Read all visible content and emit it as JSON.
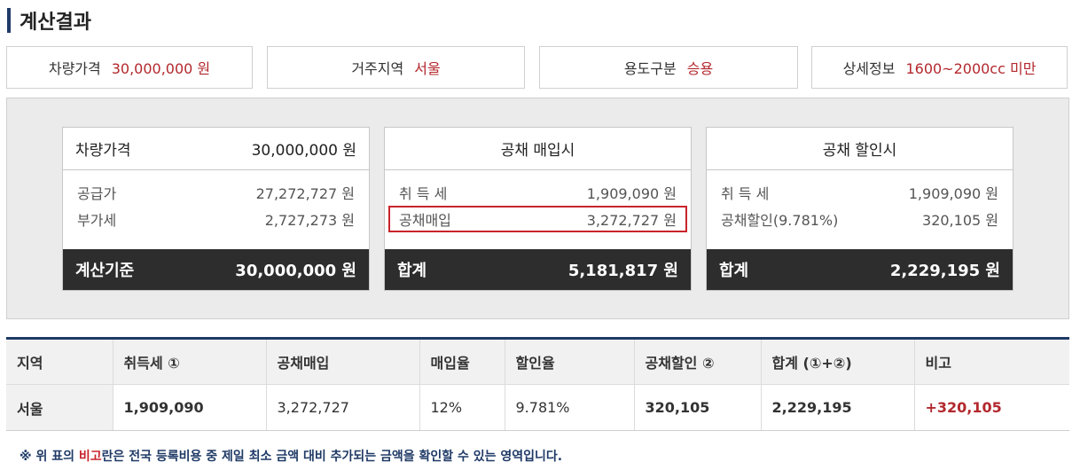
{
  "title": "계산결과",
  "summary": [
    {
      "label": "차량가격",
      "value": "30,000,000 원"
    },
    {
      "label": "거주지역",
      "value": "서울"
    },
    {
      "label": "용도구분",
      "value": "승용"
    },
    {
      "label": "상세정보",
      "value": "1600~2000cc 미만"
    }
  ],
  "cards": {
    "price": {
      "head_label": "차량가격",
      "head_value": "30,000,000 원",
      "rows": [
        {
          "label": "공급가",
          "value": "27,272,727 원"
        },
        {
          "label": "부가세",
          "value": "2,727,273 원"
        }
      ],
      "foot_label": "계산기준",
      "foot_value": "30,000,000 원"
    },
    "purchase": {
      "head_label": "공채 매입시",
      "rows": [
        {
          "label": "취 득 세",
          "value": "1,909,090 원"
        },
        {
          "label": "공채매입",
          "value": "3,272,727 원"
        }
      ],
      "foot_label": "합계",
      "foot_value": "5,181,817 원"
    },
    "discount": {
      "head_label": "공채 할인시",
      "rows": [
        {
          "label": "취 득 세",
          "value": "1,909,090 원"
        },
        {
          "label": "공채할인(9.781%)",
          "value": "320,105 원"
        }
      ],
      "foot_label": "합계",
      "foot_value": "2,229,195 원"
    }
  },
  "table": {
    "headers": [
      "지역",
      "취득세 ①",
      "공채매입",
      "매입율",
      "할인율",
      "공채할인 ②",
      "합계 (①+②)",
      "비고"
    ],
    "row": [
      "서울",
      "1,909,090",
      "3,272,727",
      "12%",
      "9.781%",
      "320,105",
      "2,229,195",
      "+320,105"
    ]
  },
  "note": {
    "prefix": "※ 위 표의 ",
    "highlight": "비고",
    "suffix": "란은 전국 등록비용 중 제일 최소 금액 대비 추가되는 금액을 확인할 수 있는 영역입니다."
  },
  "colors": {
    "accent": "#1f3a66",
    "value_red": "#b3282d",
    "highlight_border": "#c8242b",
    "dark_footer": "#2d2d2d"
  }
}
